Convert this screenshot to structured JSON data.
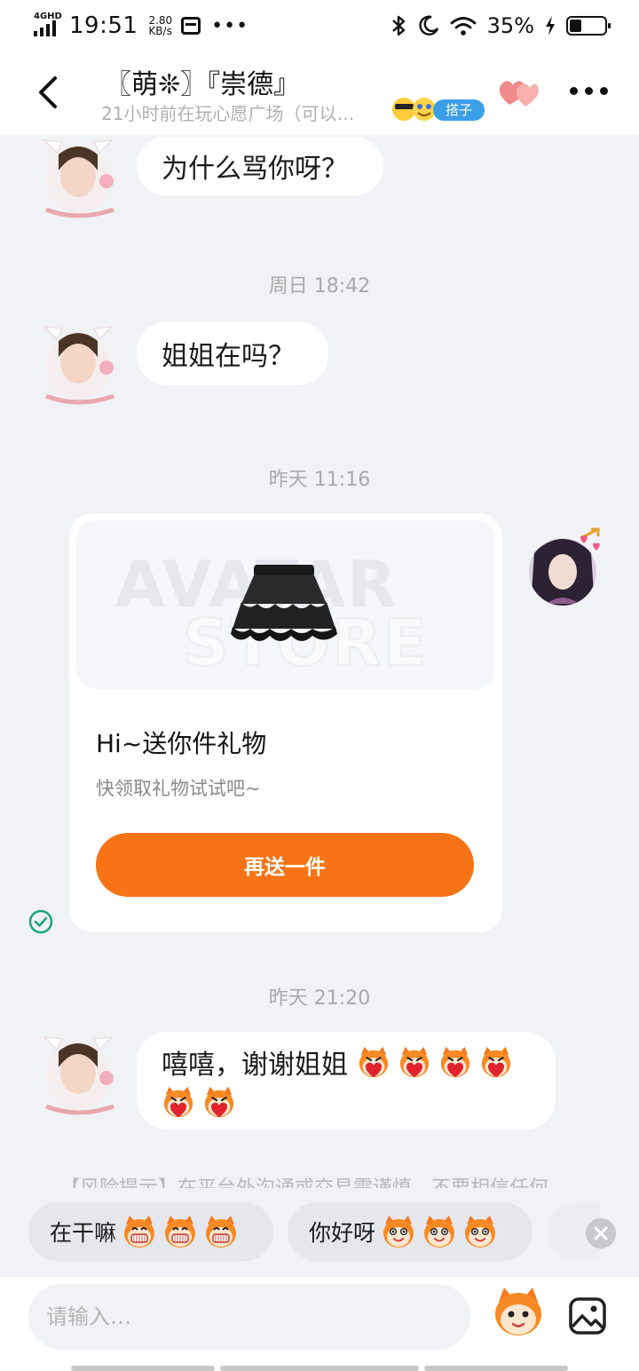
{
  "status_bar": {
    "network": "4GHD",
    "time": "19:51",
    "speed_value": "2.80",
    "speed_unit": "KB/s",
    "battery": "35%",
    "battery_level": 0.35
  },
  "header": {
    "title": "〖萌❊〗『崇德』",
    "subtitle": "21小时前在玩心愿广场（可以…",
    "tag": "搭子"
  },
  "messages": [
    {
      "type": "received",
      "text": "为什么骂你呀？"
    },
    {
      "type": "time",
      "text": "周日 18:42"
    },
    {
      "type": "received",
      "text": "姐姐在吗？"
    },
    {
      "type": "time",
      "text": "昨天 11:16"
    },
    {
      "type": "gift_card",
      "watermark_top": "AVATAR",
      "watermark_bottom": "STORE",
      "title": "Hi~送你件礼物",
      "subtitle": "快领取礼物试试吧~",
      "button": "再送一件"
    },
    {
      "type": "time",
      "text": "昨天 21:20"
    },
    {
      "type": "received",
      "text": "嘻嘻，谢谢姐姐"
    }
  ],
  "risk_notice": "【风险提示】在平台外沟通或交易需谨慎，不要相信任何",
  "quick_replies": [
    {
      "label": "在干嘛"
    },
    {
      "label": "你好呀"
    }
  ],
  "input": {
    "placeholder": "请输入…"
  },
  "colors": {
    "accent": "#f67415",
    "tag": "#3a9fe8",
    "check": "#1aa37a",
    "background": "#f1f2f6"
  },
  "icons": [
    "back-chevron-icon",
    "hearts-icon",
    "more-icon",
    "check-circle-icon",
    "close-icon",
    "mascot-emoji-icon",
    "image-icon"
  ]
}
